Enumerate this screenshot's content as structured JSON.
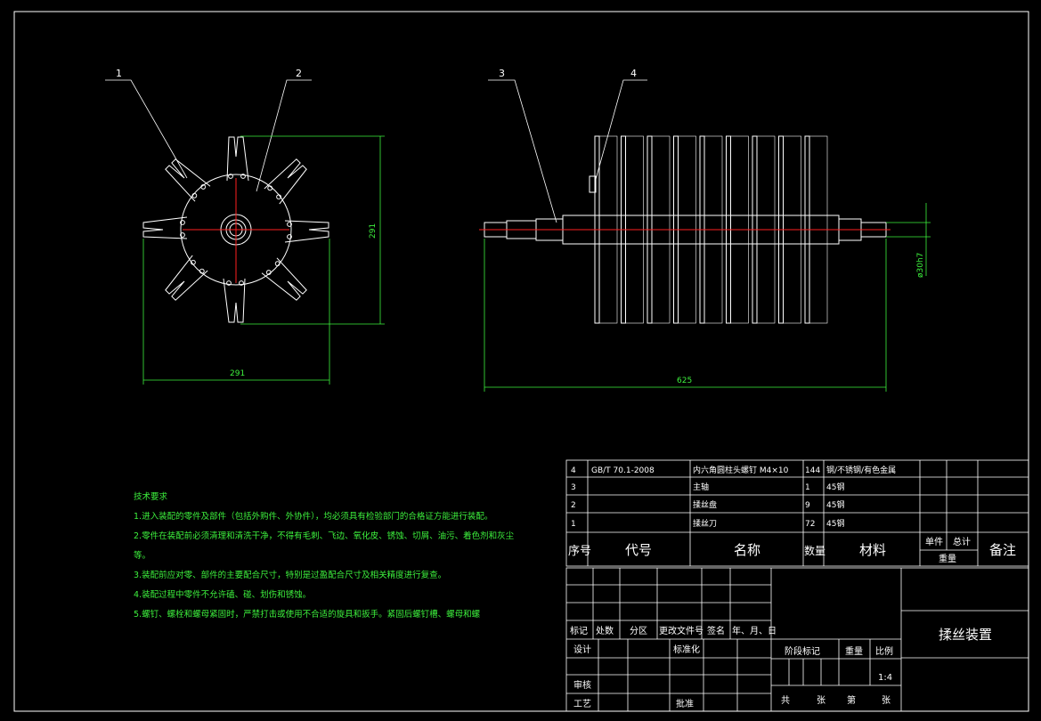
{
  "balloons": [
    "1",
    "2",
    "3",
    "4"
  ],
  "dims": {
    "height": "291",
    "width": "291",
    "length": "625",
    "diameter": "ø30h7"
  },
  "notes": {
    "title": "技术要求",
    "items": [
      "1.进入装配的零件及部件（包括外购件、外协件），均必须具有检验部门的合格证方能进行装配。",
      "2.零件在装配前必须清理和清洗干净，不得有毛刺、飞边、氧化皮、锈蚀、切屑、油污、着色剂和灰尘等。",
      "3.装配前应对零、部件的主要配合尺寸，特别是过盈配合尺寸及相关精度进行复查。",
      "4.装配过程中零件不允许磕、碰、划伤和锈蚀。",
      "5.螺钉、螺栓和螺母紧固时，严禁打击或使用不合适的旋具和扳手。紧固后螺钉槽、螺母和螺"
    ]
  },
  "bom": {
    "rows": [
      {
        "no": "4",
        "code": "GB/T 70.1-2008",
        "name": "内六角圆柱头螺钉 M4×10",
        "qty": "144",
        "mat": "钢/不锈钢/有色金属"
      },
      {
        "no": "3",
        "code": "",
        "name": "主轴",
        "qty": "1",
        "mat": "45钢"
      },
      {
        "no": "2",
        "code": "",
        "name": "揉丝盘",
        "qty": "9",
        "mat": "45钢"
      },
      {
        "no": "1",
        "code": "",
        "name": "揉丝刀",
        "qty": "72",
        "mat": "45钢"
      }
    ],
    "header": {
      "no": "序号",
      "code": "代号",
      "name": "名称",
      "qty": "数量",
      "mat": "材料",
      "single": "单件",
      "total": "总计",
      "weight": "重量",
      "remark": "备注"
    }
  },
  "title_block": {
    "marks": "标记",
    "zones": "处数",
    "area": "分区",
    "doc": "更改文件号",
    "sign": "签名",
    "date": "年、月、日",
    "design": "设计",
    "standard": "标准化",
    "check": "审核",
    "process": "工艺",
    "approve": "批准",
    "stage": "阶段标记",
    "weight": "重量",
    "scale": "比例",
    "scale_val": "1:4",
    "total": "共",
    "sheets": "张",
    "di": "第",
    "zhang": "张",
    "drawing_name": "揉丝装置"
  },
  "colors": {
    "line": "#ffffff",
    "center": "#ff2020",
    "dim": "#3df03d",
    "annot": "#ffff66"
  }
}
